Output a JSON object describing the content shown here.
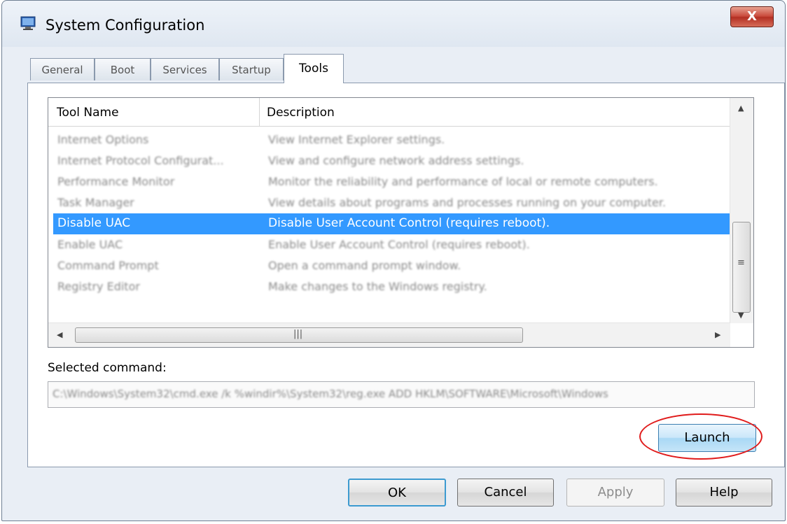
{
  "window": {
    "title": "System Configuration",
    "close_label": "X"
  },
  "tabs": [
    {
      "label": "General"
    },
    {
      "label": "Boot"
    },
    {
      "label": "Services"
    },
    {
      "label": "Startup"
    },
    {
      "label": "Tools",
      "active": true
    }
  ],
  "list": {
    "columns": [
      "Tool Name",
      "Description"
    ],
    "rows": [
      {
        "name": "Internet Options",
        "description": "View Internet Explorer settings."
      },
      {
        "name": "Internet Protocol Configurat...",
        "description": "View and configure network address settings."
      },
      {
        "name": "Performance Monitor",
        "description": "Monitor the reliability and performance of local or remote computers."
      },
      {
        "name": "Task Manager",
        "description": "View details about programs and processes running on your computer."
      },
      {
        "name": "Disable UAC",
        "description": "Disable User Account Control (requires reboot).",
        "selected": true
      },
      {
        "name": "Enable UAC",
        "description": "Enable User Account Control (requires reboot)."
      },
      {
        "name": "Command Prompt",
        "description": "Open a command prompt window."
      },
      {
        "name": "Registry Editor",
        "description": "Make changes to the Windows registry."
      }
    ]
  },
  "selected_command": {
    "label": "Selected command:",
    "value": "C:\\Windows\\System32\\cmd.exe /k %windir%\\System32\\reg.exe ADD HKLM\\SOFTWARE\\Microsoft\\Windows"
  },
  "buttons": {
    "launch": "Launch",
    "ok": "OK",
    "cancel": "Cancel",
    "apply": "Apply",
    "help": "Help"
  },
  "colors": {
    "selection": "#3399ff",
    "highlight_circle": "#e01b1b"
  }
}
